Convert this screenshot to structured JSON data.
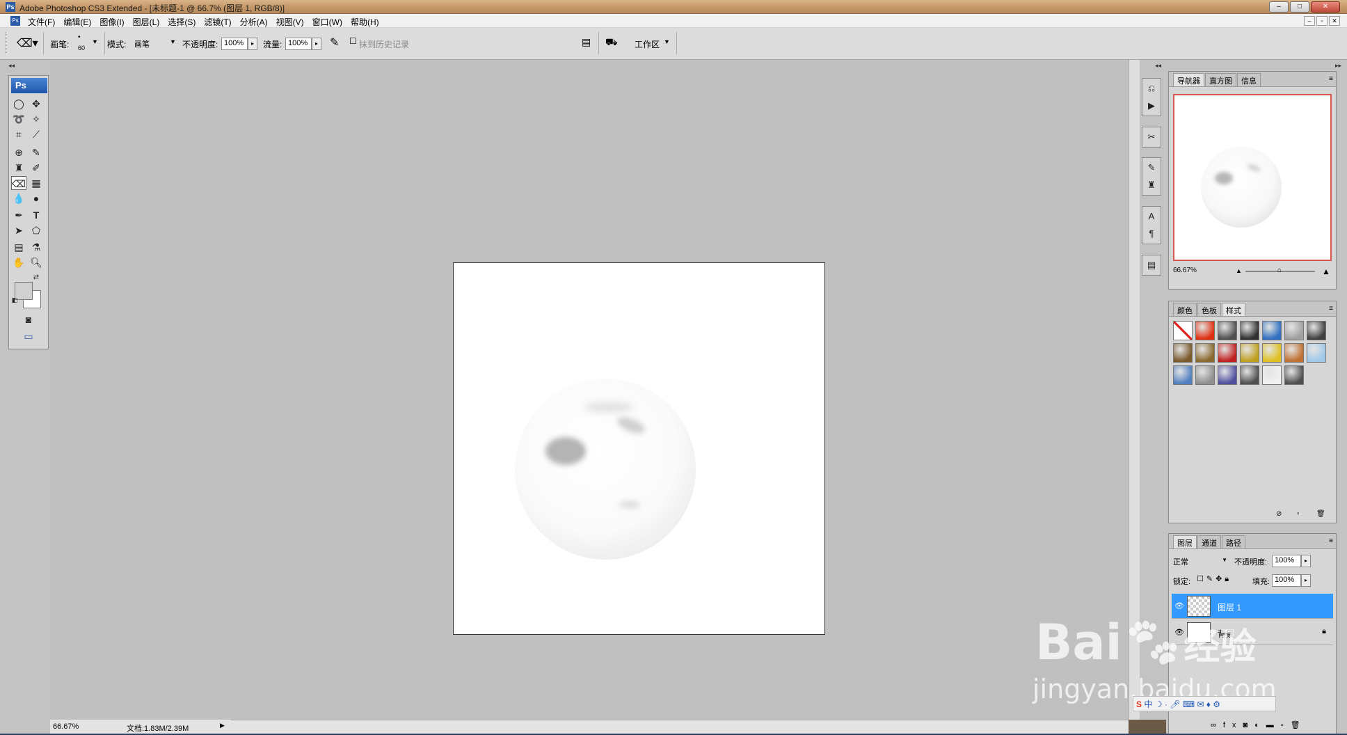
{
  "window": {
    "title": "Adobe Photoshop CS3 Extended - [未标题-1 @ 66.7% (图层 1, RGB/8)]",
    "app_badge": "Ps"
  },
  "menu": [
    "文件(F)",
    "编辑(E)",
    "图像(I)",
    "图层(L)",
    "选择(S)",
    "滤镜(T)",
    "分析(A)",
    "视图(V)",
    "窗口(W)",
    "帮助(H)"
  ],
  "options": {
    "brush_label": "画笔:",
    "brush_size": "60",
    "mode_label": "模式:",
    "mode_value": "画笔",
    "opacity_label": "不透明度:",
    "opacity_value": "100%",
    "flow_label": "流量:",
    "flow_value": "100%",
    "erase_history_label": "抹到历史记录",
    "workspace_label": "工作区"
  },
  "toolbox": {
    "logo": "Ps"
  },
  "status": {
    "zoom": "66.67%",
    "doc": "文档:1.83M/2.39M"
  },
  "navigator": {
    "tabs": [
      "导航器",
      "直方图",
      "信息"
    ],
    "zoom": "66.67%"
  },
  "styles": {
    "tabs": [
      "颜色",
      "色板",
      "样式"
    ],
    "swatches": [
      "#ffffff",
      "#e03010",
      "#505050",
      "#303030",
      "#3070c0",
      "#a0a0a0",
      "#404040",
      "#7a5a2a",
      "#8a6a30",
      "#c02020",
      "#c0a020",
      "#e0c020",
      "#c07030",
      "#a0c8e8",
      "#5080c0",
      "#909090",
      "#5050a0",
      "#505050",
      "#f0f0f0",
      "#505050"
    ]
  },
  "layers": {
    "tabs": [
      "图层",
      "通道",
      "路径"
    ],
    "blend_mode": "正常",
    "opacity_label": "不透明度:",
    "opacity_value": "100%",
    "lock_label": "锁定:",
    "fill_label": "填充:",
    "fill_value": "100%",
    "items": [
      {
        "name": "图层 1",
        "selected": true
      },
      {
        "name": "背景",
        "selected": false
      }
    ]
  },
  "watermark": {
    "brand": "Bai",
    "brand_suffix": "经验",
    "url": "jingyan.baidu.com",
    "ime": "中"
  }
}
